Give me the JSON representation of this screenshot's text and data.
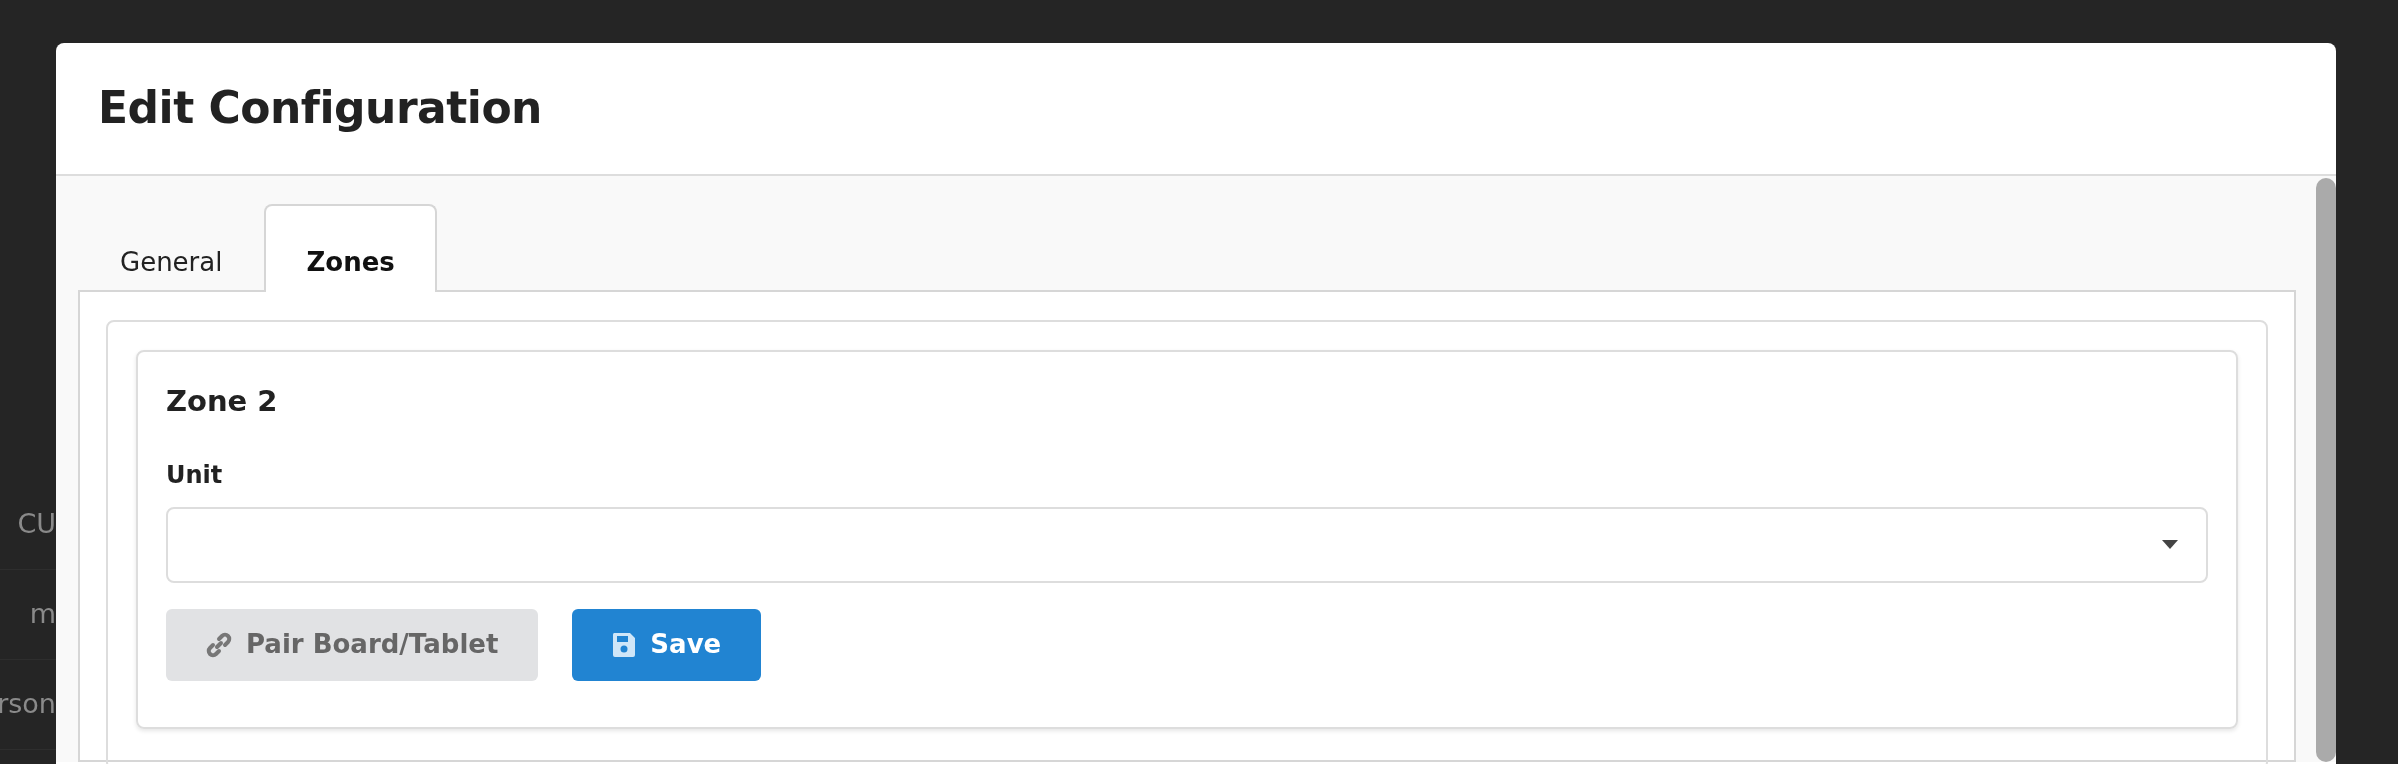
{
  "background_rows": [
    {
      "text": "CU"
    },
    {
      "text": "m"
    },
    {
      "text": "rson"
    }
  ],
  "dialog": {
    "title": "Edit Configuration",
    "tabs": [
      {
        "label": "General",
        "selected": false
      },
      {
        "label": "Zones",
        "selected": true
      }
    ],
    "zone": {
      "title": "Zone 2",
      "field": {
        "label": "Unit"
      },
      "buttons": [
        {
          "label": "Pair Board/Tablet",
          "kind": "pair",
          "disabled": true
        },
        {
          "label": "Save",
          "kind": "save",
          "disabled": false
        }
      ]
    }
  }
}
